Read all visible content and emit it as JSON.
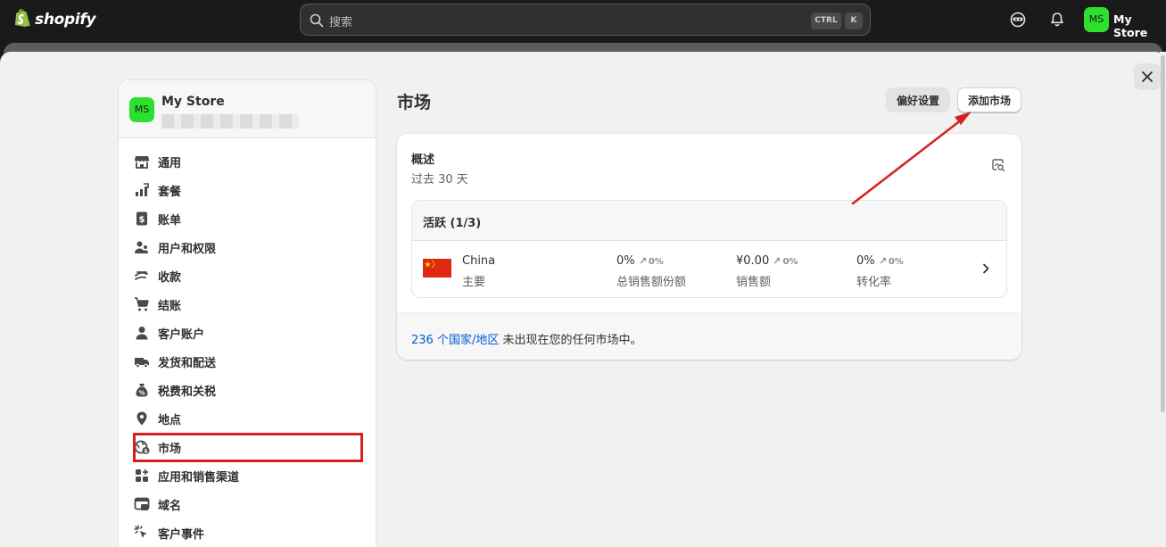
{
  "topbar": {
    "brand": "shopify",
    "search_placeholder": "搜索",
    "kbd_ctrl": "CTRL",
    "kbd_k": "K",
    "avatar_initials": "MS",
    "store_name": "My Store"
  },
  "sidebar": {
    "avatar_initials": "MS",
    "store_name": "My Store",
    "items": [
      {
        "label": "通用",
        "icon": "store-icon"
      },
      {
        "label": "套餐",
        "icon": "plan-chart-icon"
      },
      {
        "label": "账单",
        "icon": "billing-icon"
      },
      {
        "label": "用户和权限",
        "icon": "users-icon"
      },
      {
        "label": "收款",
        "icon": "payments-icon"
      },
      {
        "label": "结账",
        "icon": "cart-icon"
      },
      {
        "label": "客户账户",
        "icon": "person-icon"
      },
      {
        "label": "发货和配送",
        "icon": "truck-icon"
      },
      {
        "label": "税费和关税",
        "icon": "tax-icon"
      },
      {
        "label": "地点",
        "icon": "location-pin-icon"
      },
      {
        "label": "市场",
        "icon": "globe-dollar-icon"
      },
      {
        "label": "应用和销售渠道",
        "icon": "apps-icon"
      },
      {
        "label": "域名",
        "icon": "domain-icon"
      },
      {
        "label": "客户事件",
        "icon": "cursor-click-icon"
      }
    ]
  },
  "main": {
    "title": "市场",
    "pref_button": "偏好设置",
    "add_button": "添加市场",
    "overview": {
      "title": "概述",
      "subtitle": "过去 30 天",
      "active_header": "活跃 (1/3)",
      "market": {
        "name": "China",
        "role": "主要",
        "metrics": [
          {
            "value": "0%",
            "change": "0%",
            "label": "总销售额份额"
          },
          {
            "value": "¥0.00",
            "change": "0%",
            "label": "销售额"
          },
          {
            "value": "0%",
            "change": "0%",
            "label": "转化率"
          }
        ]
      },
      "footer_link": "236 个国家/地区",
      "footer_text": " 未出现在您的任何市场中。"
    }
  },
  "colors": {
    "accent_link": "#005bd3",
    "avatar_green": "#2ee02e",
    "highlight_red": "#d61f1f",
    "flag_red": "#de2910"
  }
}
